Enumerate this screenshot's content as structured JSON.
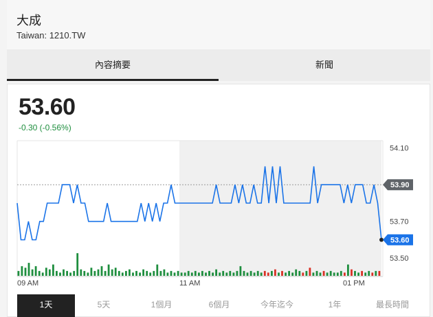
{
  "header": {
    "name": "大成",
    "ticker": "Taiwan: 1210.TW"
  },
  "tabs": [
    {
      "label": "內容摘要",
      "active": true
    },
    {
      "label": "新聞",
      "active": false
    }
  ],
  "quote": {
    "price": "53.60",
    "change": "-0.30 (-0.56%)",
    "change_color": "#1e8e3e"
  },
  "chart_data": {
    "type": "line",
    "y_ticks": [
      "54.10",
      "53.70",
      "53.50"
    ],
    "x_ticks": [
      "09 AM",
      "11 AM",
      "01 PM"
    ],
    "previous_close": {
      "label": "53.90",
      "value": 53.9
    },
    "last": {
      "label": "53.60",
      "value": 53.6
    },
    "ylim": [
      53.4,
      54.14
    ],
    "line_color": "#1a73e8",
    "series": [
      {
        "values": [
          53.8,
          53.6,
          53.6,
          53.7,
          53.6,
          53.6,
          53.7,
          53.7,
          53.8,
          53.8,
          53.8,
          53.8,
          53.9,
          53.9,
          53.9,
          53.8,
          53.9,
          53.8,
          53.8,
          53.7,
          53.7,
          53.7,
          53.7,
          53.7,
          53.8,
          53.7,
          53.7,
          53.7,
          53.7,
          53.7,
          53.7,
          53.7,
          53.7,
          53.8,
          53.7,
          53.8,
          53.7,
          53.8,
          53.7,
          53.8,
          53.8,
          53.9,
          53.8,
          53.8,
          53.8,
          53.8,
          53.8,
          53.8,
          53.8,
          53.8,
          53.8,
          53.8,
          53.8,
          53.9,
          53.8,
          53.8,
          53.8,
          53.8,
          53.9,
          53.8,
          53.9,
          53.8,
          53.8,
          53.9,
          53.8,
          53.8,
          54.0,
          53.8,
          54.0,
          53.8,
          54.0,
          53.8,
          53.8,
          53.8,
          53.8,
          53.8,
          53.8,
          53.8,
          53.8,
          54.0,
          53.8,
          53.9,
          53.9,
          53.9,
          53.9,
          53.9,
          53.9,
          53.8,
          53.9,
          53.8,
          53.9,
          53.9,
          53.9,
          53.8,
          53.8,
          53.9,
          53.8,
          53.6
        ]
      }
    ],
    "volume": {
      "up_color": "#1e8e3e",
      "down_color": "#d93025",
      "bars": [
        [
          3,
          "u"
        ],
        [
          6,
          "u"
        ],
        [
          5,
          "u"
        ],
        [
          8,
          "u"
        ],
        [
          4,
          "u"
        ],
        [
          6,
          "u"
        ],
        [
          3,
          "u"
        ],
        [
          2,
          "u"
        ],
        [
          5,
          "u"
        ],
        [
          4,
          "u"
        ],
        [
          7,
          "u"
        ],
        [
          3,
          "u"
        ],
        [
          2,
          "u"
        ],
        [
          4,
          "u"
        ],
        [
          3,
          "u"
        ],
        [
          2,
          "u"
        ],
        [
          3,
          "u"
        ],
        [
          14,
          "u"
        ],
        [
          4,
          "u"
        ],
        [
          3,
          "u"
        ],
        [
          2,
          "u"
        ],
        [
          5,
          "u"
        ],
        [
          3,
          "u"
        ],
        [
          4,
          "u"
        ],
        [
          6,
          "u"
        ],
        [
          3,
          "u"
        ],
        [
          7,
          "u"
        ],
        [
          4,
          "u"
        ],
        [
          5,
          "u"
        ],
        [
          3,
          "u"
        ],
        [
          2,
          "u"
        ],
        [
          3,
          "u"
        ],
        [
          4,
          "u"
        ],
        [
          2,
          "u"
        ],
        [
          3,
          "u"
        ],
        [
          2,
          "u"
        ],
        [
          4,
          "u"
        ],
        [
          3,
          "u"
        ],
        [
          2,
          "u"
        ],
        [
          3,
          "u"
        ],
        [
          7,
          "u"
        ],
        [
          3,
          "u"
        ],
        [
          4,
          "u"
        ],
        [
          2,
          "u"
        ],
        [
          3,
          "u"
        ],
        [
          2,
          "u"
        ],
        [
          3,
          "u"
        ],
        [
          2,
          "u"
        ],
        [
          2,
          "u"
        ],
        [
          3,
          "u"
        ],
        [
          2,
          "u"
        ],
        [
          3,
          "u"
        ],
        [
          2,
          "u"
        ],
        [
          3,
          "u"
        ],
        [
          2,
          "u"
        ],
        [
          3,
          "u"
        ],
        [
          2,
          "u"
        ],
        [
          4,
          "u"
        ],
        [
          2,
          "u"
        ],
        [
          3,
          "u"
        ],
        [
          2,
          "u"
        ],
        [
          3,
          "u"
        ],
        [
          2,
          "u"
        ],
        [
          3,
          "u"
        ],
        [
          6,
          "u"
        ],
        [
          3,
          "u"
        ],
        [
          2,
          "u"
        ],
        [
          3,
          "u"
        ],
        [
          2,
          "u"
        ],
        [
          3,
          "u"
        ],
        [
          2,
          "u"
        ],
        [
          3,
          "d"
        ],
        [
          2,
          "d"
        ],
        [
          3,
          "u"
        ],
        [
          4,
          "d"
        ],
        [
          2,
          "u"
        ],
        [
          3,
          "d"
        ],
        [
          2,
          "u"
        ],
        [
          3,
          "u"
        ],
        [
          2,
          "u"
        ],
        [
          4,
          "u"
        ],
        [
          3,
          "u"
        ],
        [
          2,
          "d"
        ],
        [
          3,
          "u"
        ],
        [
          5,
          "d"
        ],
        [
          2,
          "u"
        ],
        [
          3,
          "u"
        ],
        [
          2,
          "u"
        ],
        [
          3,
          "d"
        ],
        [
          2,
          "u"
        ],
        [
          3,
          "u"
        ],
        [
          2,
          "u"
        ],
        [
          2,
          "u"
        ],
        [
          3,
          "u"
        ],
        [
          2,
          "d"
        ],
        [
          7,
          "u"
        ],
        [
          4,
          "d"
        ],
        [
          3,
          "u"
        ],
        [
          2,
          "u"
        ],
        [
          3,
          "d"
        ],
        [
          2,
          "u"
        ],
        [
          3,
          "u"
        ],
        [
          2,
          "d"
        ],
        [
          3,
          "u"
        ],
        [
          3,
          "d"
        ]
      ]
    }
  },
  "ranges": [
    {
      "label": "1天",
      "active": true
    },
    {
      "label": "5天",
      "active": false
    },
    {
      "label": "1個月",
      "active": false
    },
    {
      "label": "6個月",
      "active": false
    },
    {
      "label": "今年迄今",
      "active": false
    },
    {
      "label": "1年",
      "active": false
    },
    {
      "label": "最長時間",
      "active": false
    }
  ]
}
